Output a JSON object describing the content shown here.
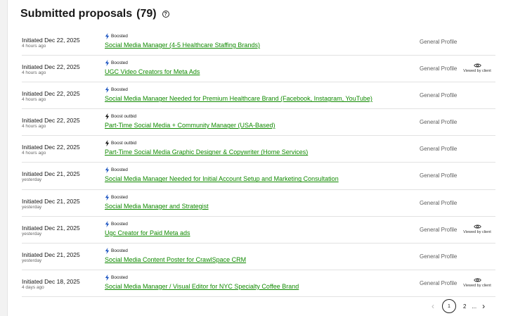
{
  "header": {
    "title": "Submitted proposals",
    "count": "(79)",
    "help_glyph": "?"
  },
  "profile_label": "General Profile",
  "viewed_label": "Viewed by client",
  "proposals": [
    {
      "date": "Initiated Dec 22, 2025",
      "ago": "4 hours ago",
      "badge": "Boosted",
      "title": "Social Media Manager (4-5 Healthcare Staffing Brands)",
      "viewed": false
    },
    {
      "date": "Initiated Dec 22, 2025",
      "ago": "4 hours ago",
      "badge": "Boosted",
      "title": "UGC Video Creators for Meta Ads",
      "viewed": true
    },
    {
      "date": "Initiated Dec 22, 2025",
      "ago": "4 hours ago",
      "badge": "Boosted",
      "title": "Social Media Manager Needed for Premium Healthcare Brand (Facebook, Instagram, YouTube)",
      "viewed": false
    },
    {
      "date": "Initiated Dec 22, 2025",
      "ago": "4 hours ago",
      "badge": "Boost outbid",
      "title": "Part-Time Social Media + Community Manager (USA-Based)",
      "viewed": false
    },
    {
      "date": "Initiated Dec 22, 2025",
      "ago": "4 hours ago",
      "badge": "Boost outbid",
      "title": "Part-Time Social Media Graphic Designer & Copywriter (Home Services)",
      "viewed": false
    },
    {
      "date": "Initiated Dec 21, 2025",
      "ago": "yesterday",
      "badge": "Boosted",
      "title": "Social Media Manager Needed for Initial Account Setup and Marketing Consultation",
      "viewed": false
    },
    {
      "date": "Initiated Dec 21, 2025",
      "ago": "yesterday",
      "badge": "Boosted",
      "title": "Social Media Manager and Strategist",
      "viewed": false
    },
    {
      "date": "Initiated Dec 21, 2025",
      "ago": "yesterday",
      "badge": "Boosted",
      "title": "Ugc Creator for Paid Meta ads",
      "viewed": true
    },
    {
      "date": "Initiated Dec 21, 2025",
      "ago": "yesterday",
      "badge": "Boosted",
      "title": "Social Media Content Poster for CrawlSpace CRM",
      "viewed": false
    },
    {
      "date": "Initiated Dec 18, 2025",
      "ago": "4 days ago",
      "badge": "Boosted",
      "title": "Social Media Manager / Visual Editor for NYC Specialty Coffee Brand",
      "viewed": true
    }
  ],
  "pagination": {
    "prev": "‹",
    "current": "1",
    "next_page": "2",
    "ellipsis": "...",
    "next": "›"
  },
  "colors": {
    "link": "#108a00",
    "bolt_boosted": "#1f57c3",
    "bolt_outbid": "#181818"
  },
  "icons": {
    "boost": "bolt-icon",
    "viewed": "eye-icon",
    "help": "help-icon"
  }
}
